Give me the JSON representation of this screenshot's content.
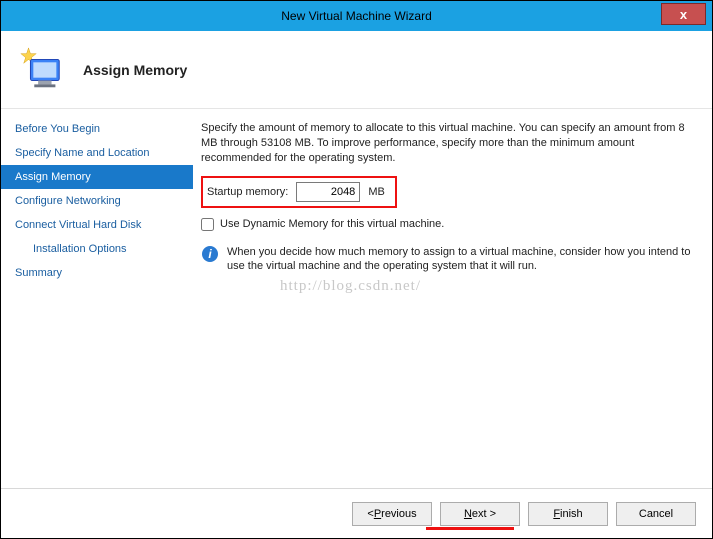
{
  "titlebar": {
    "title": "New Virtual Machine Wizard",
    "close": "x"
  },
  "header": {
    "title": "Assign Memory"
  },
  "sidebar": {
    "items": [
      {
        "label": "Before You Begin"
      },
      {
        "label": "Specify Name and Location"
      },
      {
        "label": "Assign Memory"
      },
      {
        "label": "Configure Networking"
      },
      {
        "label": "Connect Virtual Hard Disk"
      },
      {
        "label": "Installation Options"
      },
      {
        "label": "Summary"
      }
    ]
  },
  "content": {
    "description": "Specify the amount of memory to allocate to this virtual machine. You can specify an amount from 8 MB through 53108 MB. To improve performance, specify more than the minimum amount recommended for the operating system.",
    "startup_label": "Startup memory:",
    "startup_value": "2048",
    "startup_unit": "MB",
    "dynamic_label": "Use Dynamic Memory for this virtual machine.",
    "info_text": "When you decide how much memory to assign to a virtual machine, consider how you intend to use the virtual machine and the operating system that it will run."
  },
  "footer": {
    "previous": "< Previous",
    "next": "Next >",
    "finish": "Finish",
    "cancel": "Cancel"
  },
  "watermark": "http://blog.csdn.net/"
}
